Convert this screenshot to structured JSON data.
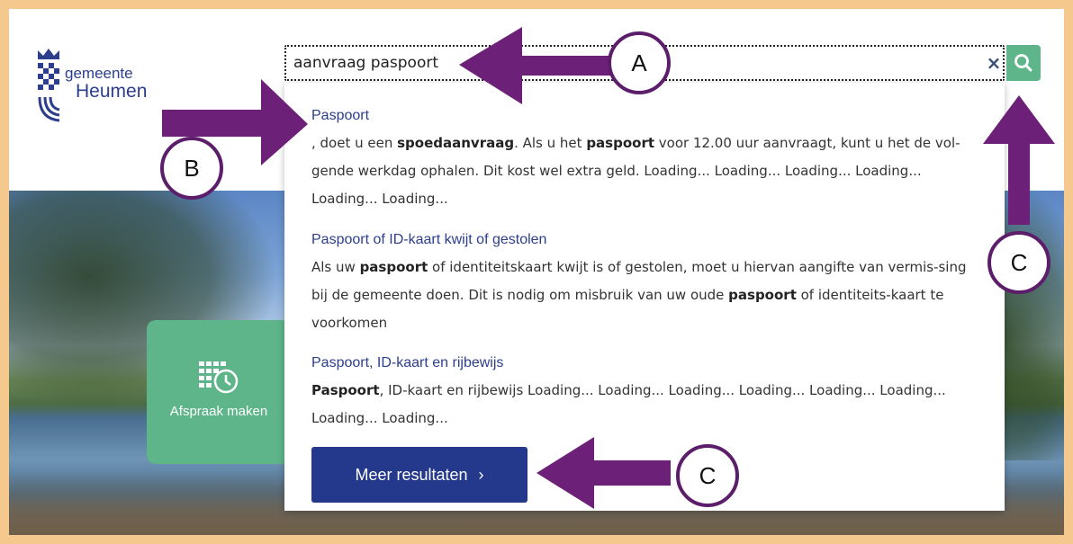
{
  "logo": {
    "line1": "gemeente",
    "line2": "Heumen"
  },
  "search": {
    "value": "aanvraag paspoort",
    "clear_symbol": "×"
  },
  "results": [
    {
      "title": "Paspoort",
      "segments": [
        ", doet u een ",
        "spoedaanvraag",
        ". Als u het ",
        "paspoort",
        " voor 12.00 uur aanvraagt, kunt u het de vol-gende werkdag ophalen. Dit kost wel extra geld.  Loading... Loading... Loading... Loading... Loading... Loading..."
      ]
    },
    {
      "title": "Paspoort of ID-kaart kwijt of gestolen",
      "segments": [
        "Als uw ",
        "paspoort",
        " of identiteitskaart kwijt is of gestolen, moet u hiervan aangifte van vermis-sing bij de gemeente doen. Dit is nodig om misbruik van uw oude ",
        "paspoort",
        " of identiteits-kaart te voorkomen"
      ]
    },
    {
      "title": "Paspoort, ID-kaart en rijbewijs",
      "segments": [
        "Paspoort",
        ", ID-kaart en rijbewijs Loading... Loading... Loading... Loading... Loading... Loading... Loading... Loading..."
      ]
    }
  ],
  "more_button": {
    "label": "Meer resultaten",
    "chevron": "›"
  },
  "tile": {
    "label": "Afspraak maken"
  },
  "annotations": {
    "a": "A",
    "b": "B",
    "c1": "C",
    "c2": "C"
  },
  "colors": {
    "brand_blue": "#24398c",
    "link_blue": "#2c3e8c",
    "green": "#5eb58a",
    "arrow_purple": "#6d2077",
    "frame": "#f5c88e"
  }
}
